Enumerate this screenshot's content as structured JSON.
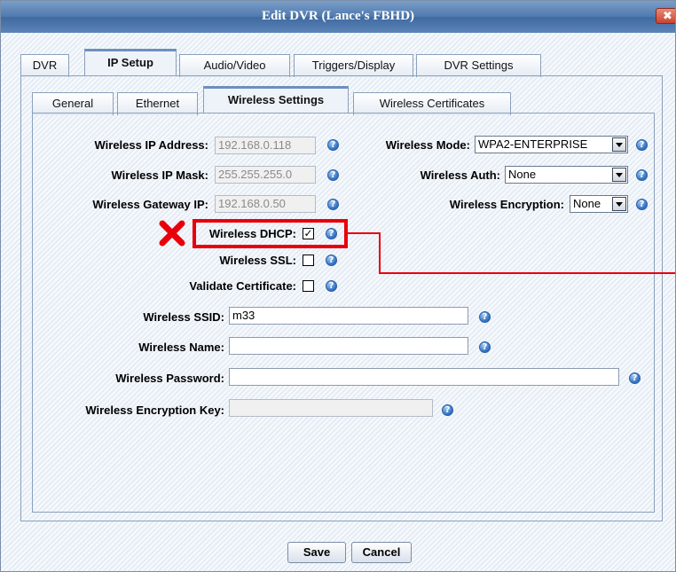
{
  "window": {
    "title": "Edit DVR (Lance's FBHD)",
    "close_label": "✖"
  },
  "tabs": [
    "DVR",
    "IP Setup",
    "Audio/Video",
    "Triggers/Display",
    "DVR Settings"
  ],
  "subtabs": [
    "General",
    "Ethernet",
    "Wireless Settings",
    "Wireless Certificates"
  ],
  "fields": {
    "ip_address": {
      "label": "Wireless IP Address:",
      "value": "192.168.0.118"
    },
    "ip_mask": {
      "label": "Wireless IP Mask:",
      "value": "255.255.255.0"
    },
    "gateway": {
      "label": "Wireless Gateway IP:",
      "value": "192.168.0.50"
    },
    "dhcp": {
      "label": "Wireless DHCP:",
      "checked": true,
      "mark": "✓"
    },
    "ssl": {
      "label": "Wireless SSL:",
      "checked": false
    },
    "validate": {
      "label": "Validate Certificate:",
      "checked": false
    },
    "ssid": {
      "label": "Wireless SSID:",
      "value": "m33"
    },
    "name": {
      "label": "Wireless Name:",
      "value": ""
    },
    "password": {
      "label": "Wireless Password:",
      "value": ""
    },
    "enc_key": {
      "label": "Wireless Encryption Key:",
      "value": ""
    },
    "mode": {
      "label": "Wireless Mode:",
      "value": "WPA2-ENTERPRISE"
    },
    "auth": {
      "label": "Wireless Auth:",
      "value": "None"
    },
    "encryption": {
      "label": "Wireless Encryption:",
      "value": "None"
    }
  },
  "help_glyph": "?",
  "buttons": {
    "save": "Save",
    "cancel": "Cancel"
  },
  "annotation_color": "#e8000a"
}
